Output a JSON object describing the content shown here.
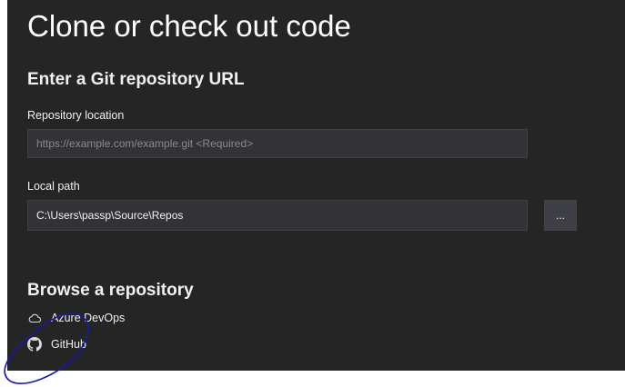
{
  "page": {
    "title": "Clone or check out code"
  },
  "git_url_section": {
    "title": "Enter a Git repository URL",
    "repository_location": {
      "label": "Repository location",
      "value": "",
      "placeholder": "https://example.com/example.git <Required>"
    },
    "local_path": {
      "label": "Local path",
      "value": "C:\\Users\\passp\\Source\\Repos",
      "browse_label": "..."
    }
  },
  "browse_section": {
    "title": "Browse a repository",
    "providers": [
      {
        "label": "Azure DevOps",
        "icon": "cloud-icon"
      },
      {
        "label": "GitHub",
        "icon": "github-icon"
      }
    ]
  },
  "colors": {
    "background": "#252526",
    "field_background": "#333337",
    "button_background": "#3f3f46",
    "text": "#f1f1f1",
    "placeholder": "#8a8a8a",
    "annotation_ink": "#1a1aa8"
  }
}
